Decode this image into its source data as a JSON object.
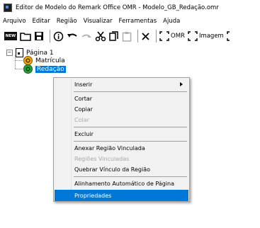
{
  "window": {
    "title": "Editor de Modelo do Remark Office OMR - Modelo_GB_Redação.omr"
  },
  "menubar": {
    "items": [
      {
        "label": "Arquivo"
      },
      {
        "label": "Editar"
      },
      {
        "label": "Região"
      },
      {
        "label": "Visualizar"
      },
      {
        "label": "Ferramentas"
      },
      {
        "label": "Ajuda"
      }
    ]
  },
  "toolbar": {
    "new_label": "NEW",
    "omr_label": "OMR",
    "image_label": "Imagem"
  },
  "tree": {
    "page_label": "Página 1",
    "items": [
      {
        "label": "Matrícula",
        "icon": "omr-region-icon",
        "color": "#e8a317"
      },
      {
        "label": "Redação",
        "icon": "image-region-icon",
        "color": "#2e9e3b",
        "selected": true
      }
    ]
  },
  "context_menu": {
    "items": [
      {
        "label": "Inserir",
        "submenu": true
      },
      {
        "label": "Cortar"
      },
      {
        "label": "Copiar"
      },
      {
        "label": "Colar",
        "disabled": true
      },
      {
        "label": "Excluir"
      },
      {
        "label": "Anexar Região Vinculada"
      },
      {
        "label": "Regiões Vinculadas",
        "disabled": true
      },
      {
        "label": "Quebrar Vínculo da Região"
      },
      {
        "label": "Alinhamento Automático de Página"
      },
      {
        "label": "Propriedades",
        "highlighted": true
      }
    ]
  },
  "colors": {
    "selection": "#0078d7",
    "menu_background": "#f2f2f2"
  }
}
